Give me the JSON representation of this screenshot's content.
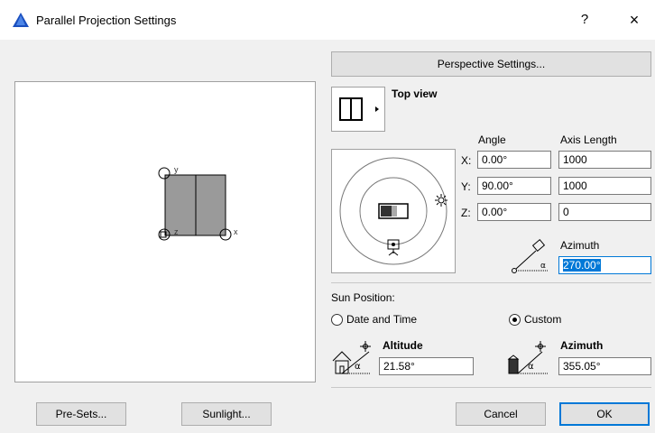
{
  "window": {
    "title": "Parallel Projection Settings",
    "help": "?",
    "close": "×"
  },
  "perspective_button": "Perspective Settings...",
  "view": {
    "label": "Top view"
  },
  "table": {
    "angle_header": "Angle",
    "axis_header": "Axis Length",
    "rows": [
      {
        "axis": "X:",
        "angle": "0.00°",
        "length": "1000"
      },
      {
        "axis": "Y:",
        "angle": "90.00°",
        "length": "1000"
      },
      {
        "axis": "Z:",
        "angle": "0.00°",
        "length": "0"
      }
    ]
  },
  "view_azimuth": {
    "label": "Azimuth",
    "value": "270.00°"
  },
  "sun": {
    "heading": "Sun Position:",
    "date_time": "Date and Time",
    "custom": "Custom",
    "selected": "custom",
    "altitude_label": "Altitude",
    "altitude": "21.58°",
    "azimuth_label": "Azimuth",
    "azimuth": "355.05°"
  },
  "preview_axes": {
    "x": "x",
    "y": "y",
    "z": "z"
  },
  "buttons": {
    "presets": "Pre-Sets...",
    "sunlight": "Sunlight...",
    "cancel": "Cancel",
    "ok": "OK"
  },
  "colors": {
    "accent": "#0078d7",
    "face": "#e1e1e1"
  }
}
